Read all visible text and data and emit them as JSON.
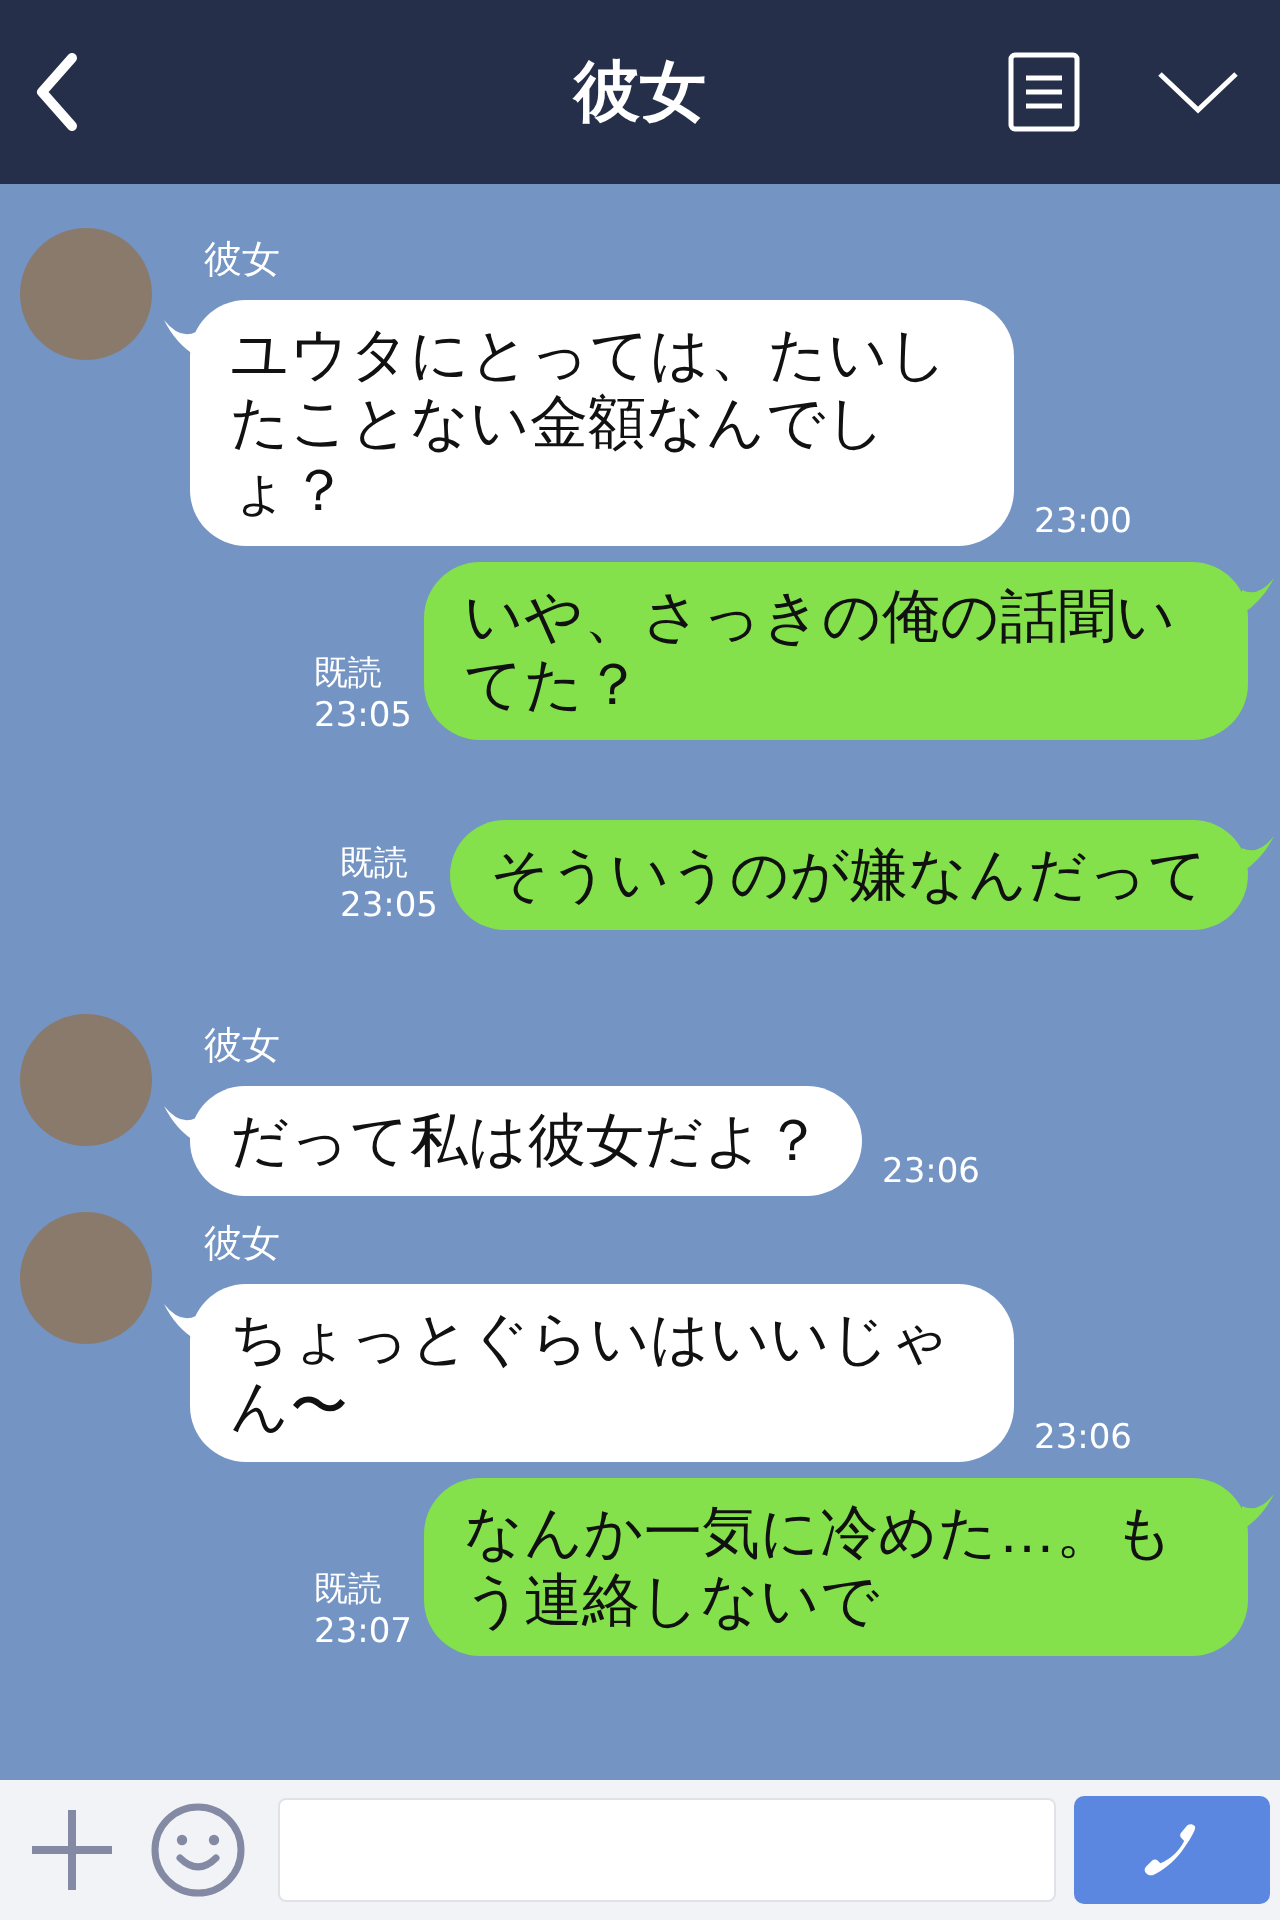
{
  "header": {
    "title": "彼女"
  },
  "messages": [
    {
      "kind": "received",
      "sender": "彼女",
      "text": "ユウタにとっては、たいしたことない金額なんでしょ？",
      "time": "23:00"
    },
    {
      "kind": "sent",
      "read": "既読",
      "time": "23:05",
      "text": "いや、さっきの俺の話聞いてた？"
    },
    {
      "kind": "sent",
      "read": "既読",
      "time": "23:05",
      "text": "そういうのが嫌なんだって"
    },
    {
      "kind": "received",
      "sender": "彼女",
      "text": "だって私は彼女だよ？",
      "time": "23:06"
    },
    {
      "kind": "received",
      "sender": "彼女",
      "text": "ちょっとぐらいはいいじゃん〜",
      "time": "23:06"
    },
    {
      "kind": "sent",
      "read": "既読",
      "time": "23:07",
      "text": "なんか一気に冷めた…。もう連絡しないで"
    }
  ]
}
